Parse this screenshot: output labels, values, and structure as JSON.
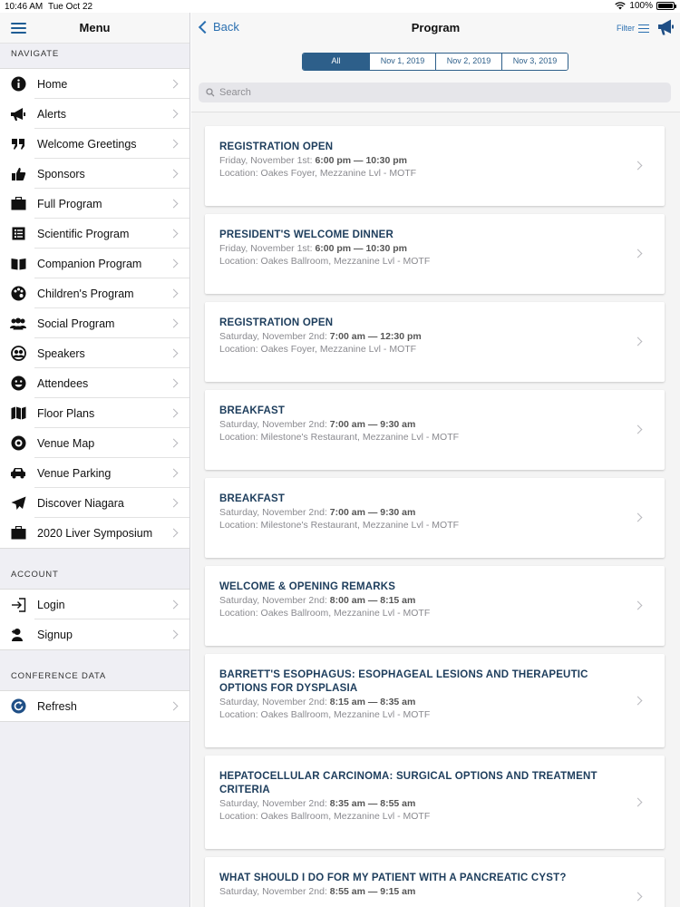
{
  "status": {
    "time": "10:46 AM",
    "date": "Tue Oct 22",
    "battery": "100%"
  },
  "sidebar": {
    "title": "Menu",
    "navigate_label": "NAVIGATE",
    "navigate": [
      {
        "label": "Home",
        "icon": "info-icon"
      },
      {
        "label": "Alerts",
        "icon": "megaphone-icon"
      },
      {
        "label": "Welcome Greetings",
        "icon": "quote-icon"
      },
      {
        "label": "Sponsors",
        "icon": "thumbs-up-icon"
      },
      {
        "label": "Full Program",
        "icon": "briefcase-icon"
      },
      {
        "label": "Scientific Program",
        "icon": "list-icon"
      },
      {
        "label": "Companion Program",
        "icon": "book-icon"
      },
      {
        "label": "Children's Program",
        "icon": "palette-icon"
      },
      {
        "label": "Social Program",
        "icon": "group-icon"
      },
      {
        "label": "Speakers",
        "icon": "speakers-icon"
      },
      {
        "label": "Attendees",
        "icon": "smiley-icon"
      },
      {
        "label": "Floor Plans",
        "icon": "map-icon"
      },
      {
        "label": "Venue Map",
        "icon": "compass-icon"
      },
      {
        "label": "Venue Parking",
        "icon": "car-icon"
      },
      {
        "label": "Discover Niagara",
        "icon": "paper-plane-icon"
      },
      {
        "label": "2020 Liver Symposium",
        "icon": "briefcase-icon"
      }
    ],
    "account_label": "ACCOUNT",
    "account": [
      {
        "label": "Login",
        "icon": "login-icon"
      },
      {
        "label": "Signup",
        "icon": "user-plus-icon"
      }
    ],
    "conference_label": "CONFERENCE DATA",
    "conference": [
      {
        "label": "Refresh",
        "icon": "refresh-icon"
      }
    ]
  },
  "header": {
    "back_label": "Back",
    "title": "Program",
    "filter_label": "Filter"
  },
  "tabs": [
    "All",
    "Nov 1, 2019",
    "Nov 2, 2019",
    "Nov 3, 2019"
  ],
  "search": {
    "placeholder": "Search"
  },
  "events": [
    {
      "title": "REGISTRATION OPEN",
      "date": "Friday, November 1st:",
      "time": "6:00 pm — 10:30 pm",
      "location": "Location: Oakes Foyer, Mezzanine Lvl - MOTF"
    },
    {
      "title": "PRESIDENT'S WELCOME DINNER",
      "date": "Friday, November 1st:",
      "time": "6:00 pm — 10:30 pm",
      "location": "Location: Oakes Ballroom, Mezzanine Lvl - MOTF"
    },
    {
      "title": "REGISTRATION OPEN",
      "date": "Saturday, November 2nd:",
      "time": "7:00 am — 12:30 pm",
      "location": "Location: Oakes Foyer, Mezzanine Lvl - MOTF"
    },
    {
      "title": "BREAKFAST",
      "date": "Saturday, November 2nd:",
      "time": "7:00 am — 9:30 am",
      "location": "Location: Milestone's Restaurant, Mezzanine Lvl - MOTF"
    },
    {
      "title": "BREAKFAST",
      "date": "Saturday, November 2nd:",
      "time": "7:00 am — 9:30 am",
      "location": "Location: Milestone's Restaurant, Mezzanine Lvl - MOTF"
    },
    {
      "title": "WELCOME & OPENING REMARKS",
      "date": "Saturday, November 2nd:",
      "time": "8:00 am — 8:15 am",
      "location": "Location: Oakes Ballroom, Mezzanine Lvl - MOTF"
    },
    {
      "title": "BARRETT'S ESOPHAGUS: ESOPHAGEAL LESIONS AND THERAPEUTIC OPTIONS FOR DYSPLASIA",
      "date": "Saturday, November 2nd:",
      "time": "8:15 am — 8:35 am",
      "location": "Location: Oakes Ballroom, Mezzanine Lvl - MOTF"
    },
    {
      "title": "HEPATOCELLULAR CARCINOMA: SURGICAL OPTIONS AND TREATMENT CRITERIA",
      "date": "Saturday, November 2nd:",
      "time": "8:35 am — 8:55 am",
      "location": "Location: Oakes Ballroom, Mezzanine Lvl - MOTF"
    },
    {
      "title": "WHAT SHOULD I DO FOR MY PATIENT WITH A PANCREATIC CYST?",
      "date": "Saturday, November 2nd:",
      "time": "8:55 am — 9:15 am",
      "location": ""
    }
  ],
  "colors": {
    "accent": "#2a6fb0",
    "segment": "#2d5f8a",
    "title": "#1d3d5c"
  }
}
